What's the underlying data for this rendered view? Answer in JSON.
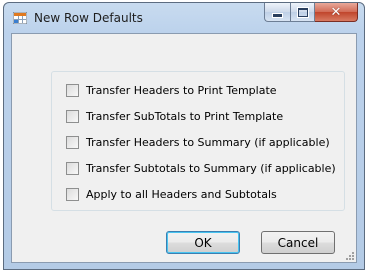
{
  "window": {
    "title": "New Row Defaults",
    "controls": {
      "minimize": "minimize",
      "maximize": "maximize",
      "close": "close"
    }
  },
  "options": [
    {
      "label": "Transfer Headers to Print Template",
      "checked": false
    },
    {
      "label": "Transfer SubTotals to Print Template",
      "checked": false
    },
    {
      "label": "Transfer Headers to Summary (if applicable)",
      "checked": false
    },
    {
      "label": "Transfer Subtotals to Summary (if applicable)",
      "checked": false
    },
    {
      "label": "Apply to all Headers and Subtotals",
      "checked": false
    }
  ],
  "buttons": {
    "ok": "OK",
    "cancel": "Cancel"
  },
  "colors": {
    "titlebar": "#bcd2ec",
    "client": "#f0f0f0",
    "close": "#c0452c",
    "default_button_border": "#3c7fb1"
  }
}
